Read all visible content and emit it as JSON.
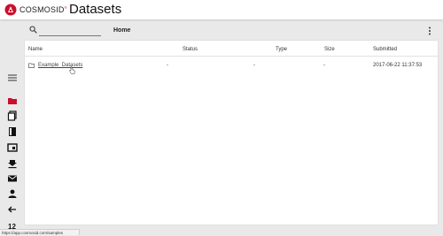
{
  "header": {
    "brand": "COSMOSID",
    "brand_mark": "®",
    "page_title": "Datasets"
  },
  "colors": {
    "accent": "#c8102e",
    "icon_dark": "#111111"
  },
  "sidebar": {
    "items": [
      {
        "icon": "menu-icon"
      },
      {
        "icon": "folder-icon",
        "active": true
      },
      {
        "icon": "copy-icon"
      },
      {
        "icon": "book-icon"
      },
      {
        "icon": "image-box-icon"
      },
      {
        "icon": "download-icon"
      },
      {
        "icon": "mail-icon"
      },
      {
        "icon": "person-icon"
      },
      {
        "icon": "arrow-left-icon"
      }
    ],
    "count": "12"
  },
  "toolbar": {
    "search_value": "",
    "breadcrumb": "Home"
  },
  "table": {
    "columns": [
      "Name",
      "Status",
      "Type",
      "Size",
      "Submitted"
    ],
    "rows": [
      {
        "name": "Example_Datasets",
        "status": "-",
        "type": "-",
        "size": "-",
        "submitted": "2017-06-22 11:37:53"
      }
    ]
  },
  "statusbar": {
    "url": "https://app.cosmosid.com/samples"
  }
}
